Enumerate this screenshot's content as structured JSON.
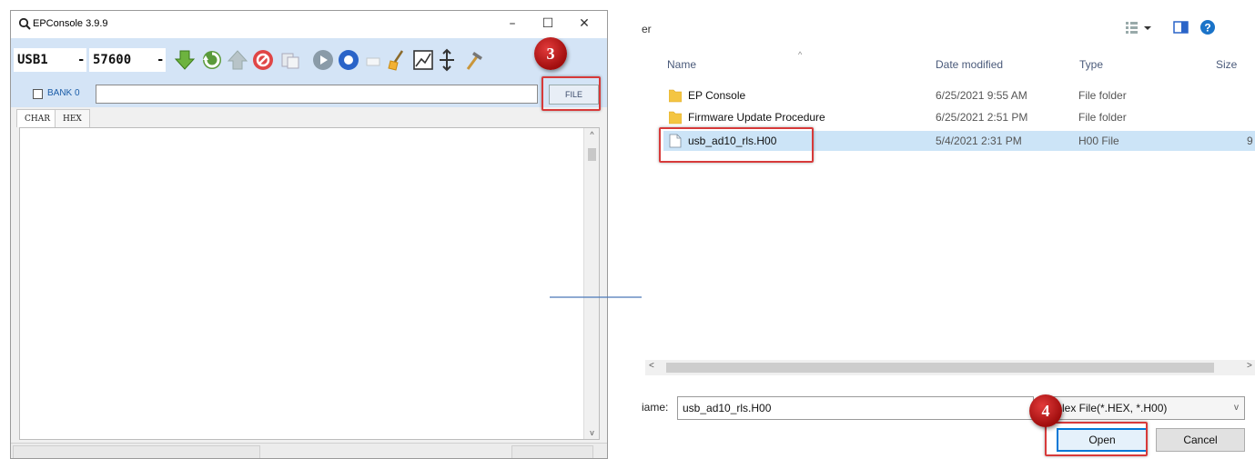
{
  "ep_console": {
    "title": "EPConsole 3.9.9",
    "window_controls": {
      "minimize": "–",
      "maximize": "☐",
      "close": "✕"
    },
    "port": "USB1",
    "baud": "57600",
    "bank_label": "BANK 0",
    "path_value": "",
    "file_button_label": "FILE",
    "tabs": [
      "CHAR",
      "HEX"
    ],
    "icons": [
      "download-arrow-icon",
      "refresh-icon",
      "upload-arrow-icon",
      "stop-icon",
      "copy-icon",
      "play-icon",
      "record-icon",
      "blank-icon",
      "broom-icon",
      "chart-icon",
      "split-icon",
      "hammer-icon"
    ]
  },
  "file_dialog": {
    "header_fragment": "er",
    "columns": [
      "Name",
      "Date modified",
      "Type",
      "Size"
    ],
    "files": [
      {
        "name": "EP Console",
        "date": "6/25/2021 9:55 AM",
        "type": "File folder",
        "size": "",
        "kind": "folder"
      },
      {
        "name": "Firmware Update Procedure",
        "date": "6/25/2021 2:51 PM",
        "type": "File folder",
        "size": "",
        "kind": "folder"
      },
      {
        "name": "usb_ad10_rls.H00",
        "date": "5/4/2021 2:31 PM",
        "type": "H00 File",
        "size": "9",
        "kind": "file",
        "selected": true
      }
    ],
    "file_name_label": "iame:",
    "file_name_value": "usb_ad10_rls.H00",
    "filter_value": "lex File(*.HEX, *.H00)",
    "open_label": "Open",
    "cancel_label": "Cancel"
  },
  "callouts": {
    "step3": "3",
    "step4": "4"
  },
  "colors": {
    "callout_red": "#d73a3a",
    "selection_blue": "#cce4f7",
    "toolbar_blue": "#d4e4f6",
    "arrow_blue": "#4a78b8"
  }
}
